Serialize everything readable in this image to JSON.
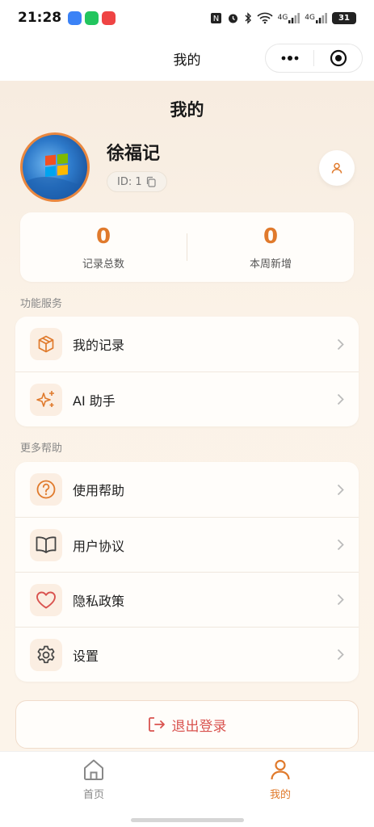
{
  "status_bar": {
    "time": "21:28",
    "network_1": "4G",
    "network_2": "4G",
    "battery": "31",
    "app_icons": [
      {
        "name": "message-app-icon",
        "color": "#3b82f6"
      },
      {
        "name": "green-app-icon",
        "color": "#22c55e"
      },
      {
        "name": "red-app-icon",
        "color": "#ef4444"
      }
    ]
  },
  "nav": {
    "title": "我的",
    "more_icon": "more-dots-icon",
    "close_icon": "target-close-icon"
  },
  "profile": {
    "page_title": "我的",
    "name": "徐福记",
    "id_text": "ID: 1",
    "copy_icon": "copy-icon",
    "profile_icon": "user-icon"
  },
  "stats": [
    {
      "value": "0",
      "label": "记录总数"
    },
    {
      "value": "0",
      "label": "本周新增"
    }
  ],
  "sections": {
    "services": {
      "label": "功能服务",
      "items": [
        {
          "label": "我的记录",
          "icon": "box-icon"
        },
        {
          "label": "AI 助手",
          "icon": "sparkle-icon"
        }
      ]
    },
    "help": {
      "label": "更多帮助",
      "items": [
        {
          "label": "使用帮助",
          "icon": "question-icon"
        },
        {
          "label": "用户协议",
          "icon": "book-icon"
        },
        {
          "label": "隐私政策",
          "icon": "heart-icon"
        },
        {
          "label": "设置",
          "icon": "gear-icon"
        }
      ]
    }
  },
  "logout": {
    "label": "退出登录",
    "icon": "logout-icon"
  },
  "tab_bar": {
    "tabs": [
      {
        "label": "首页",
        "icon": "home-icon",
        "active": false
      },
      {
        "label": "我的",
        "icon": "user-icon",
        "active": true
      }
    ]
  },
  "colors": {
    "accent": "#e07a2c",
    "danger": "#d9534f",
    "icon_bg": "#fbeee2",
    "background": "#fbf2e7"
  }
}
